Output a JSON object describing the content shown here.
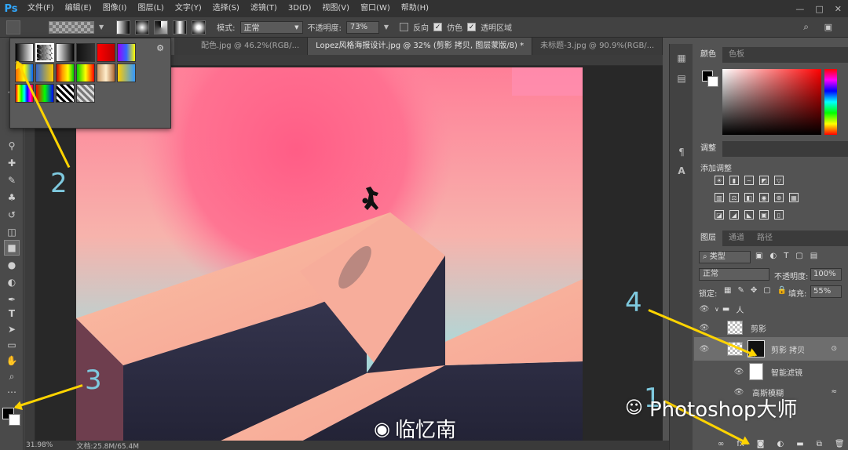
{
  "app": {
    "logo": "Ps"
  },
  "menu": [
    "文件(F)",
    "编辑(E)",
    "图像(I)",
    "图层(L)",
    "文字(Y)",
    "选择(S)",
    "滤镜(T)",
    "3D(D)",
    "视图(V)",
    "窗口(W)",
    "帮助(H)"
  ],
  "window_controls": [
    "—",
    "□",
    "✕"
  ],
  "options": {
    "mode_label": "模式:",
    "mode_value": "正常",
    "opacity_label": "不透明度:",
    "opacity_value": "73%",
    "reverse_label": "反向",
    "dither_label": "仿色",
    "transparency_label": "透明区域"
  },
  "tabs": [
    {
      "label": "配色.jpg @ 46.2%(RGB/...",
      "active": false
    },
    {
      "label": "Lopez风格海报设计.jpg @ 32% (剪影 拷贝, 图层蒙版/8) *",
      "active": true
    },
    {
      "label": "未标题-3.jpg @ 90.9%(RGB/...",
      "active": false
    }
  ],
  "color_panel": {
    "tabs": [
      "颜色",
      "色板"
    ]
  },
  "adjust_panel": {
    "tab": "调整",
    "title": "添加调整"
  },
  "layers_panel": {
    "tabs": [
      "图层",
      "通道",
      "路径"
    ],
    "filter_kind": "类型",
    "blend_mode": "正常",
    "opacity_label": "不透明度:",
    "opacity_value": "100%",
    "lock_label": "锁定:",
    "fill_label": "填充:",
    "fill_value": "55%",
    "layers": [
      {
        "name": "人",
        "type": "group"
      },
      {
        "name": "剪影",
        "type": "smart"
      },
      {
        "name": "剪影 拷贝",
        "type": "smart",
        "selected": true
      },
      {
        "name": "智能滤镜",
        "type": "filter-mask"
      },
      {
        "name": "高斯模糊",
        "type": "filter"
      }
    ]
  },
  "status": {
    "zoom": "31.98%",
    "doc": "文档:25.8M/65.4M"
  },
  "annotations": [
    "1",
    "2",
    "3",
    "4"
  ],
  "watermarks": {
    "left": "临忆南",
    "right": "Photoshop大师"
  },
  "colors": {
    "arrow": "#ffd400",
    "annotation_text": "#7ec9de",
    "ps_blue": "#31a8ff"
  }
}
